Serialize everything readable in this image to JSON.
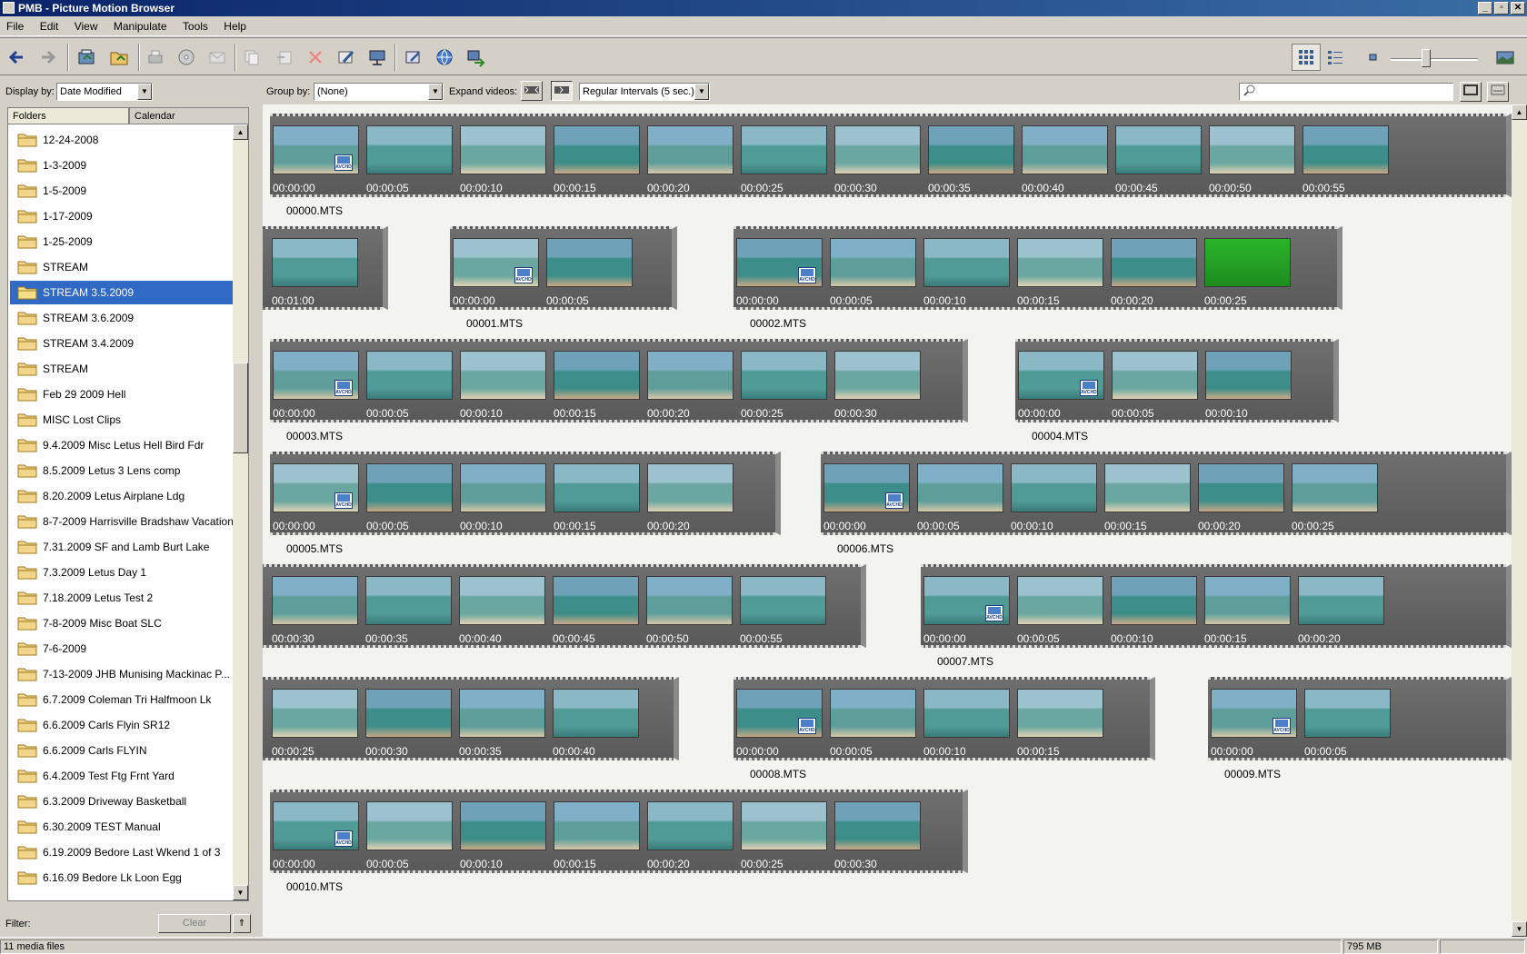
{
  "window": {
    "title": "PMB - Picture Motion Browser",
    "buttons": [
      "_",
      "▫",
      "✕"
    ]
  },
  "menu": [
    "File",
    "Edit",
    "View",
    "Manipulate",
    "Tools",
    "Help"
  ],
  "left": {
    "display_by_label": "Display by:",
    "display_by_value": "Date Modified",
    "tabs": [
      "Folders",
      "Calendar"
    ],
    "folders": [
      {
        "label": "12-24-2008",
        "selected": false
      },
      {
        "label": "1-3-2009",
        "selected": false
      },
      {
        "label": "1-5-2009",
        "selected": false
      },
      {
        "label": "1-17-2009",
        "selected": false
      },
      {
        "label": "1-25-2009",
        "selected": false
      },
      {
        "label": "STREAM",
        "selected": false
      },
      {
        "label": "STREAM 3.5.2009",
        "selected": true
      },
      {
        "label": "STREAM 3.6.2009",
        "selected": false
      },
      {
        "label": "STREAM 3.4.2009",
        "selected": false
      },
      {
        "label": "STREAM",
        "selected": false
      },
      {
        "label": "Feb 29 2009 Hell",
        "selected": false
      },
      {
        "label": "MISC Lost Clips",
        "selected": false
      },
      {
        "label": "9.4.2009 Misc Letus Hell Bird Fdr",
        "selected": false
      },
      {
        "label": "8.5.2009 Letus 3 Lens comp",
        "selected": false
      },
      {
        "label": "8.20.2009 Letus Airplane Ldg",
        "selected": false
      },
      {
        "label": "8-7-2009 Harrisville Bradshaw Vacation",
        "selected": false
      },
      {
        "label": "7.31.2009 SF and Lamb Burt Lake",
        "selected": false
      },
      {
        "label": "7.3.2009 Letus Day 1",
        "selected": false
      },
      {
        "label": "7.18.2009 Letus Test 2",
        "selected": false
      },
      {
        "label": "7-8-2009 Misc Boat SLC",
        "selected": false
      },
      {
        "label": "7-6-2009",
        "selected": false
      },
      {
        "label": "7-13-2009 JHB Munising Mackinac P...",
        "selected": false
      },
      {
        "label": "6.7.2009 Coleman Tri Halfmoon Lk",
        "selected": false
      },
      {
        "label": "6.6.2009 Carls Flyin SR12",
        "selected": false
      },
      {
        "label": "6.6.2009 Carls FLYIN",
        "selected": false
      },
      {
        "label": "6.4.2009 Test Ftg Frnt Yard",
        "selected": false
      },
      {
        "label": "6.3.2009 Driveway Basketball",
        "selected": false
      },
      {
        "label": "6.30.2009 TEST Manual",
        "selected": false
      },
      {
        "label": "6.19.2009 Bedore Last Wkend 1 of 3",
        "selected": false
      },
      {
        "label": "6.16.09 Bedore Lk Loon Egg",
        "selected": false
      }
    ],
    "filter_label": "Filter:",
    "clear_label": "Clear"
  },
  "right": {
    "group_by_label": "Group by:",
    "group_by_value": "(None)",
    "expand_label": "Expand videos:",
    "interval_value": "Regular Intervals (5 sec.)",
    "search_placeholder": ""
  },
  "badge_text": "AVCHD",
  "strips": [
    {
      "name": "00000.MTS",
      "badge": 0,
      "times": [
        "00:00:00",
        "00:00:05",
        "00:00:10",
        "00:00:15",
        "00:00:20",
        "00:00:25",
        "00:00:30",
        "00:00:35",
        "00:00:40",
        "00:00:45",
        "00:00:50",
        "00:00:55"
      ]
    },
    {
      "name": "",
      "badge": -1,
      "times": [
        "00:01:00"
      ]
    },
    {
      "name": "00001.MTS",
      "badge": 0,
      "times": [
        "00:00:00",
        "00:00:05"
      ]
    },
    {
      "name": "00002.MTS",
      "badge": 0,
      "times": [
        "00:00:00",
        "00:00:05",
        "00:00:10",
        "00:00:15",
        "00:00:20",
        "00:00:25"
      ]
    },
    {
      "name": "00003.MTS",
      "badge": 0,
      "times": [
        "00:00:00",
        "00:00:05",
        "00:00:10",
        "00:00:15",
        "00:00:20",
        "00:00:25",
        "00:00:30"
      ]
    },
    {
      "name": "00004.MTS",
      "badge": 0,
      "times": [
        "00:00:00",
        "00:00:05",
        "00:00:10"
      ]
    },
    {
      "name": "00005.MTS",
      "badge": 0,
      "times": [
        "00:00:00",
        "00:00:05",
        "00:00:10",
        "00:00:15",
        "00:00:20"
      ]
    },
    {
      "name": "00006.MTS",
      "badge": 0,
      "times": [
        "00:00:00",
        "00:00:05",
        "00:00:10",
        "00:00:15",
        "00:00:20",
        "00:00:25"
      ]
    },
    {
      "name": "",
      "badge": -1,
      "times": [
        "00:00:30",
        "00:00:35",
        "00:00:40",
        "00:00:45",
        "00:00:50",
        "00:00:55"
      ]
    },
    {
      "name": "00007.MTS",
      "badge": 0,
      "times": [
        "00:00:00",
        "00:00:05",
        "00:00:10",
        "00:00:15",
        "00:00:20"
      ]
    },
    {
      "name": "",
      "badge": -1,
      "times": [
        "00:00:25",
        "00:00:30",
        "00:00:35",
        "00:00:40"
      ]
    },
    {
      "name": "00008.MTS",
      "badge": 0,
      "times": [
        "00:00:00",
        "00:00:05",
        "00:00:10",
        "00:00:15"
      ]
    },
    {
      "name": "00009.MTS",
      "badge": 0,
      "times": [
        "00:00:00",
        "00:00:05"
      ]
    },
    {
      "name": "00010.MTS",
      "badge": 0,
      "times": [
        "00:00:00",
        "00:00:05",
        "00:00:10",
        "00:00:15",
        "00:00:20",
        "00:00:25",
        "00:00:30"
      ]
    }
  ],
  "status": {
    "left": "11 media files",
    "right": "795 MB"
  },
  "colors": {
    "title_bar": "#0a246a",
    "selection": "#316ac5",
    "strip": "#666666",
    "chrome": "#d4d0c8"
  }
}
